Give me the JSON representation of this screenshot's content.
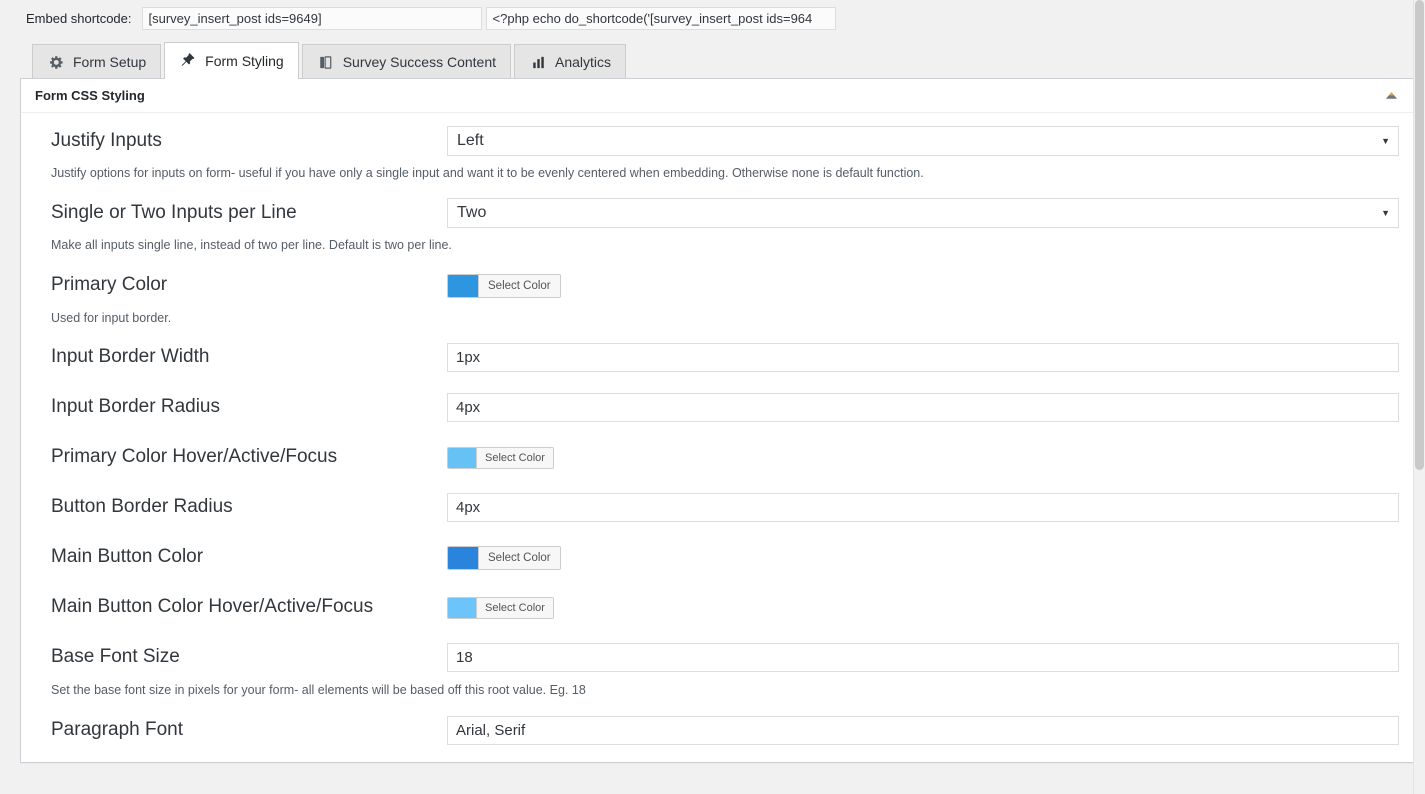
{
  "shortcode": {
    "label": "Embed shortcode:",
    "input_one_value": "[survey_insert_post ids=9649]",
    "input_two_value": "<?php echo do_shortcode('[survey_insert_post ids=964"
  },
  "tabs": [
    {
      "label": "Form Setup",
      "icon": "gear-icon",
      "active": false
    },
    {
      "label": "Form Styling",
      "icon": "pushpin-icon",
      "active": true
    },
    {
      "label": "Survey Success Content",
      "icon": "pages-icon",
      "active": false
    },
    {
      "label": "Analytics",
      "icon": "bar-chart-icon",
      "active": true
    }
  ],
  "panel": {
    "title": "Form CSS Styling",
    "toggle_icon": "caret-up-icon"
  },
  "fields": {
    "justify_inputs": {
      "label": "Justify Inputs",
      "value": "Left",
      "desc": "Justify options for inputs on form- useful if you have only a single input and want it to be evenly centered when embedding. Otherwise none is default function."
    },
    "inputs_per_line": {
      "label": "Single or Two Inputs per Line",
      "value": "Two",
      "desc": "Make all inputs single line, instead of two per line. Default is two per line."
    },
    "primary_color": {
      "label": "Primary Color",
      "button_label": "Select Color",
      "color": "#2e96e0",
      "desc": "Used for input border."
    },
    "input_border_width": {
      "label": "Input Border Width",
      "value": "1px"
    },
    "input_border_radius": {
      "label": "Input Border Radius",
      "value": "4px"
    },
    "primary_color_hover": {
      "label": "Primary Color Hover/Active/Focus",
      "button_label": "Select Color",
      "color": "#66c2f5"
    },
    "button_border_radius": {
      "label": "Button Border Radius",
      "value": "4px"
    },
    "main_button_color": {
      "label": "Main Button Color",
      "button_label": "Select Color",
      "color": "#2b84dc"
    },
    "main_button_color_hover": {
      "label": "Main Button Color Hover/Active/Focus",
      "button_label": "Select Color",
      "color": "#6cc4fb"
    },
    "base_font_size": {
      "label": "Base Font Size",
      "value": "18",
      "desc": "Set the base font size in pixels for your form- all elements will be based off this root value. Eg. 18"
    },
    "paragraph_font": {
      "label": "Paragraph Font",
      "value": "Arial, Serif"
    }
  }
}
